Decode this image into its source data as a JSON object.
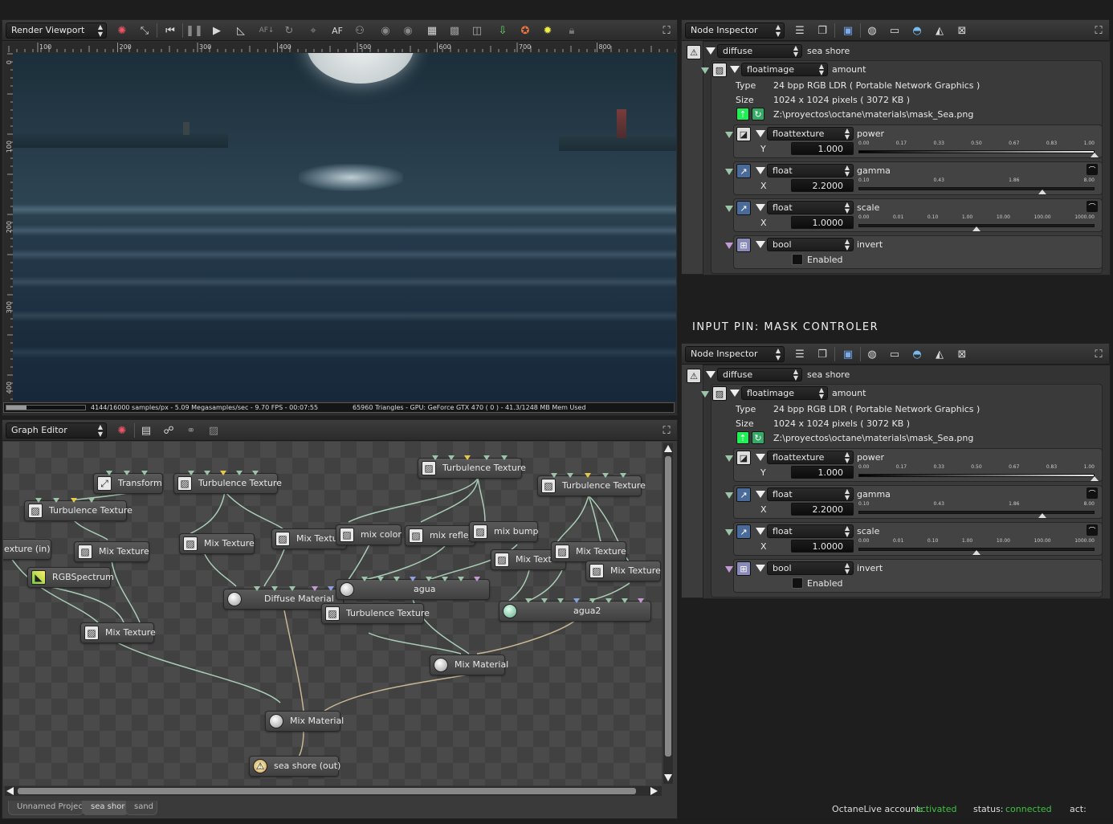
{
  "viewport": {
    "combo": "Render Viewport",
    "ruler": [
      "100",
      "200",
      "300",
      "400",
      "500",
      "600",
      "700",
      "800"
    ],
    "vruler": [
      "0",
      "100",
      "200",
      "300",
      "400"
    ],
    "status_left": "4144/16000 samples/px - 5.09 Megasamples/sec - 9.70 FPS - 00:07:55",
    "status_right": "65960 Triangles - GPU: GeForce GTX 470 ( 0 ) - 41.3/1248 MB Mem Used",
    "toolbar_text": [
      "AF"
    ]
  },
  "graph_editor": {
    "combo": "Graph Editor",
    "nodes": {
      "transform": "Transform",
      "turb1": "Turbulence Texture",
      "turb2": "Turbulence Texture",
      "turb3": "Turbulence Texture",
      "turb4": "Turbulence Texture",
      "turb5": "Turbulence Texture",
      "texture_in": "exture (in)",
      "mix1": "Mix Texture",
      "mix2": "Mix Texture",
      "mix3": "Mix Texture",
      "mixcolor": "mix color",
      "mixreflejo": "mix reflejo",
      "mixbump": "mix bump",
      "mix4": "Mix Texture",
      "mix5": "Mix Texture",
      "mix6": "Mix Texture",
      "rgb": "RGBSpectrum",
      "diffuse": "Diffuse Material",
      "agua": "agua",
      "agua2": "agua2",
      "mix7": "Mix Texture",
      "mixmat1": "Mix Material",
      "mixmat2": "Mix Material",
      "out": "sea shore (out)"
    },
    "tabs": [
      "Unnamed Project",
      "sea shore",
      "sand"
    ]
  },
  "inspector_title": "INPUT PIN: MASK CONTROLER",
  "inspectors": [
    {
      "combo": "Node Inspector",
      "mat_type": "diffuse",
      "mat_name": "sea shore",
      "img_type": "floatimage",
      "img_name": "amount",
      "type_label": "Type",
      "type_value": "24 bpp RGB LDR ( Portable Network Graphics )",
      "size_label": "Size",
      "size_value": "1024 x 1024 pixels ( 3072 KB )",
      "path": "Z:\\proyectos\\octane\\materials\\mask_Sea.png",
      "power": {
        "type": "floattexture",
        "name": "power",
        "axis": "Y",
        "value": "1.000",
        "ticks": [
          "0.00",
          "0.17",
          "0.33",
          "0.50",
          "0.67",
          "0.83",
          "1.00"
        ],
        "level": 1.0
      },
      "gamma": {
        "type": "float",
        "name": "gamma",
        "axis": "X",
        "value": "2.2000",
        "ticks": [
          "0.10",
          "0.43",
          "1.86",
          "8.00"
        ],
        "level": 0.78
      },
      "scale": {
        "type": "float",
        "name": "scale",
        "axis": "X",
        "value": "1.0000",
        "ticks": [
          "0.00",
          "0.01",
          "0.10",
          "1.00",
          "10.00",
          "100.00",
          "1000.00"
        ],
        "level": 0.5
      },
      "invert": {
        "type": "bool",
        "name": "invert",
        "label": "Enabled",
        "checked": false
      }
    },
    {
      "combo": "Node Inspector",
      "mat_type": "diffuse",
      "mat_name": "sea shore",
      "img_type": "floatimage",
      "img_name": "amount",
      "type_label": "Type",
      "type_value": "24 bpp RGB LDR ( Portable Network Graphics )",
      "size_label": "Size",
      "size_value": "1024 x 1024 pixels ( 3072 KB )",
      "path": "Z:\\proyectos\\octane\\materials\\mask_Sea.png",
      "power": {
        "type": "floattexture",
        "name": "power",
        "axis": "Y",
        "value": "1.000",
        "ticks": [
          "0.00",
          "0.17",
          "0.33",
          "0.50",
          "0.67",
          "0.83",
          "1.00"
        ],
        "level": 1.0
      },
      "gamma": {
        "type": "float",
        "name": "gamma",
        "axis": "X",
        "value": "2.2000",
        "ticks": [
          "0.10",
          "0.43",
          "1.86",
          "8.00"
        ],
        "level": 0.78
      },
      "scale": {
        "type": "float",
        "name": "scale",
        "axis": "X",
        "value": "1.0000",
        "ticks": [
          "0.00",
          "0.01",
          "0.10",
          "1.00",
          "10.00",
          "100.00",
          "1000.00"
        ],
        "level": 0.5
      },
      "invert": {
        "type": "bool",
        "name": "invert",
        "label": "Enabled",
        "checked": false
      }
    }
  ],
  "footer": {
    "account_label": "OctaneLive account:",
    "account_value": "activated",
    "status_label": "status:",
    "status_value": "connected",
    "act_label": "act:",
    "ok_color": "#3fc23f"
  }
}
